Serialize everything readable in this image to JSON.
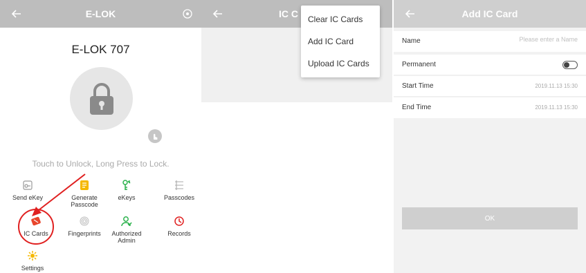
{
  "panel1": {
    "title": "E-LOK",
    "lock_name": "E-LOK 707",
    "hint": "Touch to Unlock, Long Press to Lock.",
    "menu": [
      {
        "label": "Send eKey",
        "icon": "send-ekey-icon",
        "color": "#999999"
      },
      {
        "label": "Generate Passcode",
        "icon": "generate-passcode-icon",
        "color": "#f5b800"
      },
      {
        "label": "eKeys",
        "icon": "ekeys-icon",
        "color": "#2bb24c"
      },
      {
        "label": "Passcodes",
        "icon": "passcodes-icon",
        "color": "#aaaaaa"
      },
      {
        "label": "IC Cards",
        "icon": "ic-cards-icon",
        "color": "#e8452c"
      },
      {
        "label": "Fingerprints",
        "icon": "fingerprints-icon",
        "color": "#bbbbbb"
      },
      {
        "label": "Authorized Admin",
        "icon": "authorized-admin-icon",
        "color": "#2bb24c"
      },
      {
        "label": "Records",
        "icon": "records-icon",
        "color": "#e02020"
      },
      {
        "label": "Settings",
        "icon": "settings-icon",
        "color": "#f5b800"
      }
    ]
  },
  "panel2": {
    "title": "IC C",
    "menu_items": [
      "Clear IC Cards",
      "Add IC Card",
      "Upload IC Cards"
    ]
  },
  "panel3": {
    "title": "Add IC Card",
    "name_label": "Name",
    "name_placeholder": "Please enter a Name",
    "permanent_label": "Permanent",
    "permanent_on": false,
    "start_label": "Start Time",
    "start_value": "2019.11.13 15:30",
    "end_label": "End Time",
    "end_value": "2019.11.13 15:30",
    "ok_label": "OK"
  },
  "colors": {
    "topbar": "#bdbdbd",
    "highlight": "#e02020"
  }
}
